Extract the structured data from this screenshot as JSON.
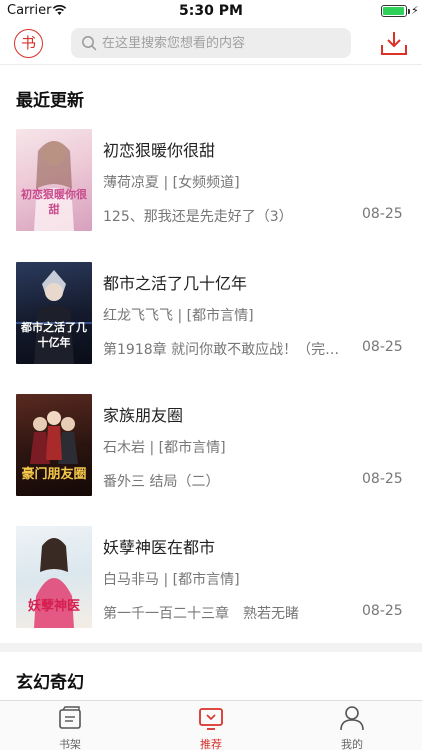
{
  "status_bar": {
    "carrier": "Carrier",
    "time": "5:30 PM",
    "battery_level": 0.95
  },
  "nav": {
    "logo": "书",
    "search_placeholder": "在这里搜索您想看的内容"
  },
  "sections": [
    {
      "title": "最近更新",
      "books": [
        {
          "title": "初恋狠暖你很甜",
          "author": "薄荷凉夏 | [女频频道]",
          "chapter": "125、那我还是先走好了（3）",
          "date": "08-25",
          "cover_text": "初恋狠暖你很甜"
        },
        {
          "title": "都市之活了几十亿年",
          "author": "红龙飞飞飞 | [都市言情]",
          "chapter": "第1918章 就问你敢不敢应战！（完本）",
          "date": "08-25",
          "cover_text": "都市之活了几十亿年"
        },
        {
          "title": "家族朋友圈",
          "author": "石木岩 | [都市言情]",
          "chapter": "番外三 结局（二）",
          "date": "08-25",
          "cover_text": "豪门朋友圈"
        },
        {
          "title": "妖孽神医在都市",
          "author": "白马非马 | [都市言情]",
          "chapter": "第一千一百二十三章　熟若无睹",
          "date": "08-25",
          "cover_text": "妖孽神医"
        }
      ]
    },
    {
      "title": "玄幻奇幻"
    }
  ],
  "tab_bar": {
    "tabs": [
      {
        "label": "书架",
        "icon": "bookshelf-icon"
      },
      {
        "label": "推荐",
        "icon": "tv-icon",
        "active": true
      },
      {
        "label": "我的",
        "icon": "user-icon"
      }
    ]
  },
  "colors": {
    "accent": "#d9322b",
    "muted_text": "#777777"
  }
}
